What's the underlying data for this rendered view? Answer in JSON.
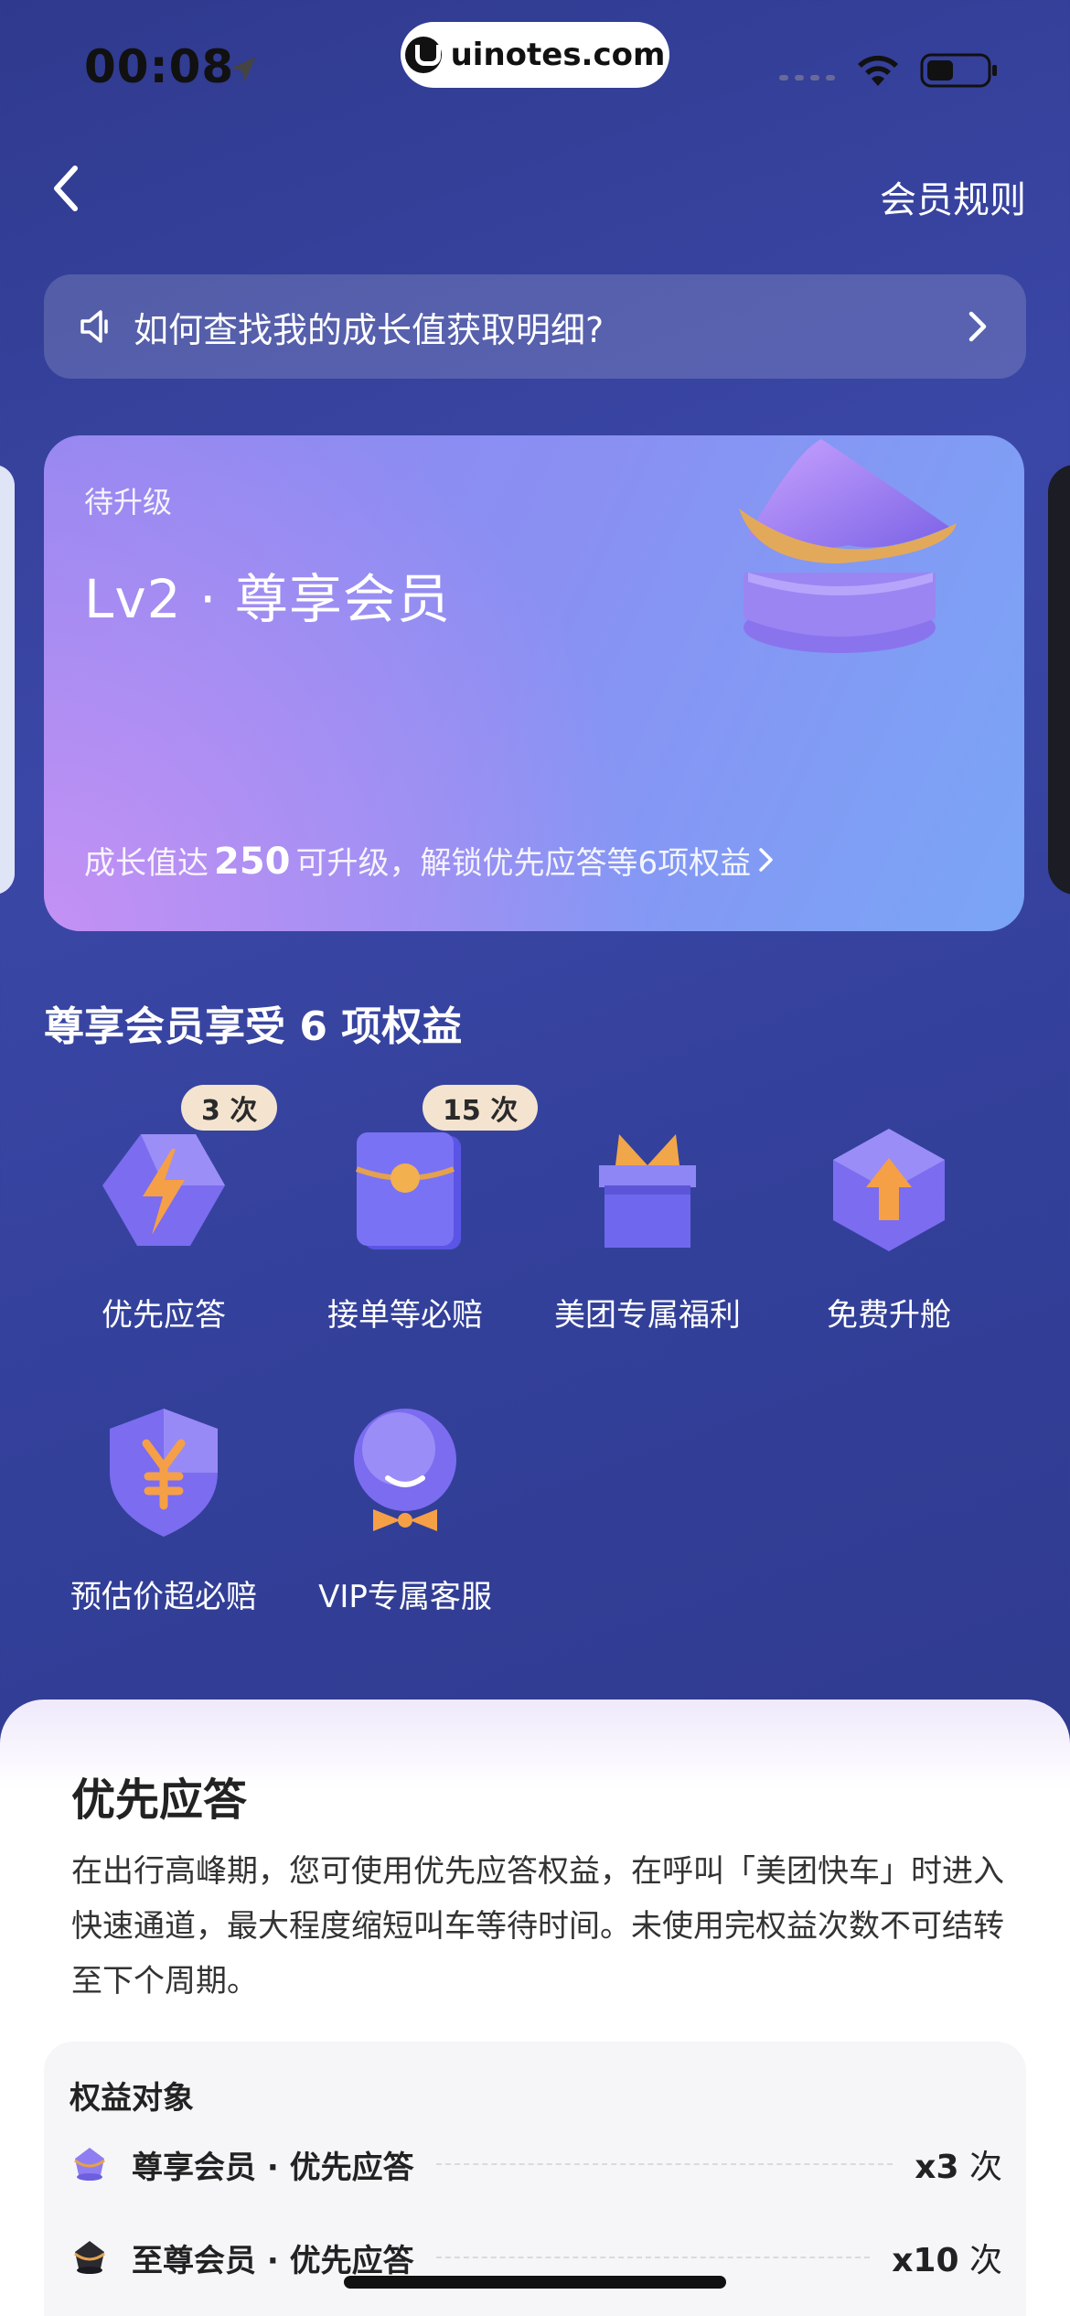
{
  "status_bar": {
    "time": "00:08"
  },
  "watermark": {
    "text": "uinotes.com"
  },
  "nav": {
    "rules_label": "会员规则"
  },
  "notice": {
    "text": "如何查找我的成长值获取明细?"
  },
  "level_card": {
    "status": "待升级",
    "level_name": "Lv2 · 尊享会员",
    "progress_prefix": "成长值达",
    "progress_value": "250",
    "progress_suffix": "可升级，解锁优先应答等6项权益"
  },
  "benefits": {
    "title": "尊享会员享受 6 项权益",
    "items": [
      {
        "label": "优先应答",
        "badge": "3 次",
        "icon": "lightning-icon"
      },
      {
        "label": "接单等必赔",
        "badge": "15 次",
        "icon": "red-envelope-icon"
      },
      {
        "label": "美团专属福利",
        "badge": "",
        "icon": "gift-icon"
      },
      {
        "label": "免费升舱",
        "badge": "",
        "icon": "upgrade-arrow-icon"
      },
      {
        "label": "预估价超必赔",
        "badge": "",
        "icon": "yuan-shield-icon"
      },
      {
        "label": "VIP专属客服",
        "badge": "",
        "icon": "customer-service-icon"
      }
    ]
  },
  "detail": {
    "title": "优先应答",
    "description": "在出行高峰期，您可使用优先应答权益，在呼叫「美团快车」时进入快速通道，最大程度缩短叫车等待时间。未使用完权益次数不可结转至下个周期。",
    "object_title": "权益对象",
    "rows": [
      {
        "name": "尊享会员 · 优先应答",
        "count": "x3",
        "unit": "次"
      },
      {
        "name": "至尊会员 · 优先应答",
        "count": "x10",
        "unit": "次"
      }
    ]
  },
  "colors": {
    "background": "#3340a0",
    "card_gradient_start": "#c491f4",
    "card_gradient_end": "#7aa5f6",
    "badge": "#f4e4cf",
    "icon_purple": "#7d6cf2",
    "icon_orange": "#f4a04a"
  }
}
